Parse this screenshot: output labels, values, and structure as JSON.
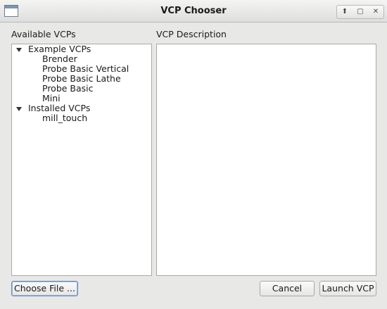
{
  "window": {
    "title": "VCP Chooser",
    "icon": "window-icon",
    "controls": [
      "maximize-icon",
      "restore-icon",
      "close-icon"
    ]
  },
  "labels": {
    "available": "Available VCPs",
    "description": "VCP Description"
  },
  "tree": {
    "groups": [
      {
        "label": "Example VCPs",
        "expanded": true,
        "items": [
          "Brender",
          "Probe Basic Vertical",
          "Probe Basic Lathe",
          "Probe Basic",
          "Mini"
        ]
      },
      {
        "label": "Installed VCPs",
        "expanded": true,
        "items": [
          "mill_touch"
        ]
      }
    ]
  },
  "description_text": "",
  "buttons": {
    "choose_file": "Choose File ...",
    "cancel": "Cancel",
    "launch": "Launch VCP"
  }
}
